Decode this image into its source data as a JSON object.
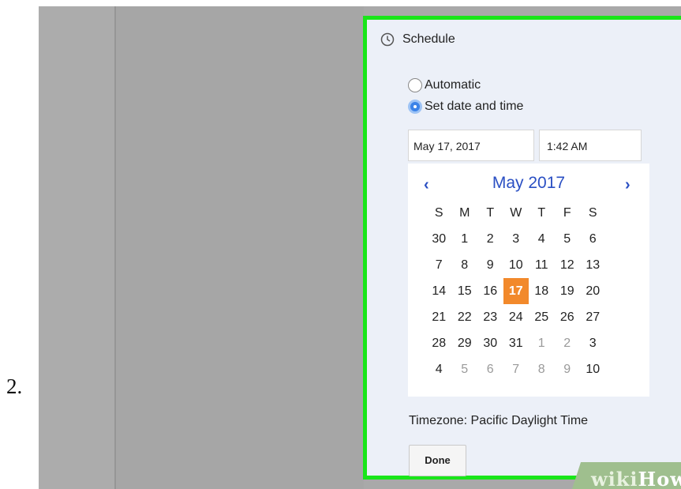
{
  "step_number": "2.",
  "schedule": {
    "title": "Schedule",
    "options": [
      {
        "label": "Automatic",
        "selected": false
      },
      {
        "label": "Set date and time",
        "selected": true
      }
    ],
    "date_value": "May 17, 2017",
    "time_value": "1:42 AM"
  },
  "calendar": {
    "prev_label": "‹",
    "next_label": "›",
    "month_title": "May 2017",
    "weekdays": [
      "S",
      "M",
      "T",
      "W",
      "T",
      "F",
      "S"
    ],
    "weeks": [
      [
        "30",
        "1",
        "2",
        "3",
        "4",
        "5",
        "6"
      ],
      [
        "7",
        "8",
        "9",
        "10",
        "11",
        "12",
        "13"
      ],
      [
        "14",
        "15",
        "16",
        "17",
        "18",
        "19",
        "20"
      ],
      [
        "21",
        "22",
        "23",
        "24",
        "25",
        "26",
        "27"
      ],
      [
        "28",
        "29",
        "30",
        "31",
        "1",
        "2",
        "3"
      ],
      [
        "4",
        "5",
        "6",
        "7",
        "8",
        "9",
        "10"
      ]
    ],
    "selected_day": "17"
  },
  "timezone_text": "Timezone: Pacific Daylight Time",
  "done_label": "Done",
  "watermark": "wikiHow",
  "colors": {
    "highlight_border": "#19e619",
    "selected_day": "#f2892b",
    "calendar_nav": "#2a4fc3",
    "radio_selected": "#3b83e8"
  }
}
